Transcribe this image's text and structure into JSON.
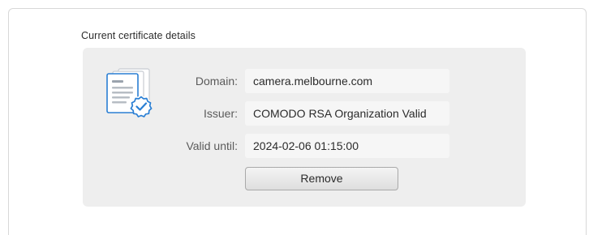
{
  "section": {
    "title": "Current certificate details"
  },
  "certificate": {
    "icon": "certificate-verified-icon",
    "accent_color": "#2a7fd4",
    "fields": [
      {
        "label": "Domain:",
        "value": "camera.melbourne.com"
      },
      {
        "label": "Issuer:",
        "value": "COMODO RSA Organization Valid"
      },
      {
        "label": "Valid until:",
        "value": "2024-02-06 01:15:00"
      }
    ]
  },
  "actions": {
    "remove_label": "Remove"
  }
}
